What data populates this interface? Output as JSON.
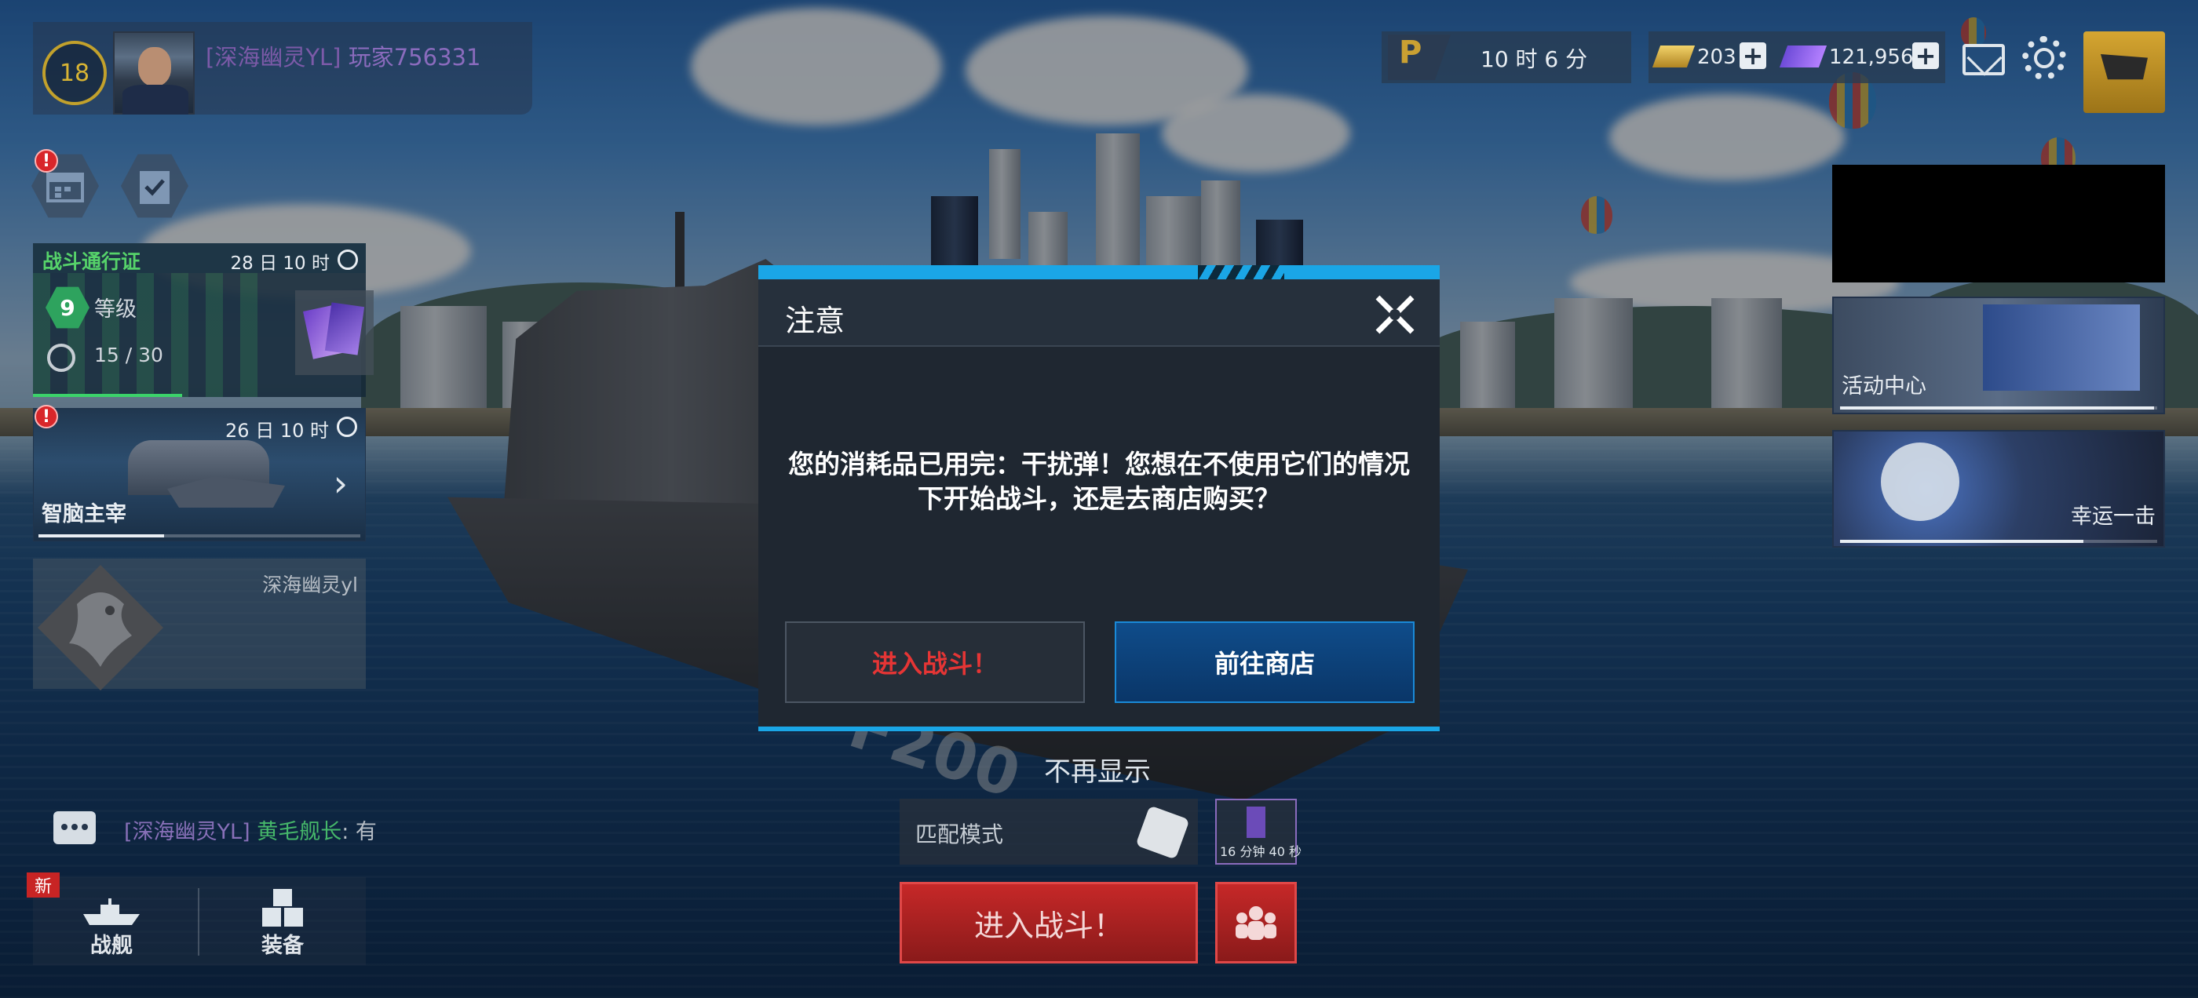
{
  "player": {
    "level": "18",
    "guild_tag": "[深海幽灵YL]",
    "name": "玩家756331"
  },
  "battle_pass": {
    "title": "战斗通行证",
    "time_left": "28 日 10 时",
    "level": "9",
    "level_label": "等级",
    "progress": "15 / 30"
  },
  "commander_event": {
    "time_left": "26 日 10 时",
    "title": "智脑主宰"
  },
  "clan": {
    "name": "深海幽灵yl"
  },
  "chat": {
    "guild": "[深海幽灵YL]",
    "sender": "黄毛舰长",
    "message": ": 有"
  },
  "nav": {
    "new_badge": "新",
    "ships_label": "战舰",
    "equipment_label": "装备"
  },
  "top_right": {
    "pass_letter": "P",
    "pass_timer": "10 时 6 分",
    "gold": "203",
    "gems": "121,956"
  },
  "side_cards": {
    "event_center": "活动中心",
    "lucky_strike": "幸运一击"
  },
  "ship_hull_number": "F200",
  "dialog": {
    "title": "注意",
    "message_line1": "您的消耗品已用完：干扰弹！您想在不使用它们的情况",
    "message_line2": "下开始战斗，还是去商店购买？",
    "enter_battle": "进入战斗！",
    "go_shop": "前往商店"
  },
  "bottom_center": {
    "dont_show": "不再显示",
    "mode": "匹配模式",
    "slot_timer": "16 分钟 40 秒",
    "battle_button": "进入战斗！"
  },
  "colors": {
    "accent_blue": "#1aa6e6",
    "danger_red": "#e53535",
    "pass_green": "#56d36a",
    "gold": "#c9a032"
  }
}
